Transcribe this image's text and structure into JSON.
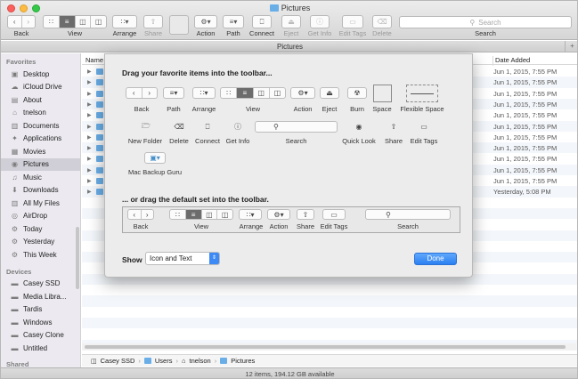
{
  "window": {
    "title": "Pictures",
    "tab_title": "Pictures",
    "status": "12 items, 194.12 GB available"
  },
  "toolbar": {
    "back": "Back",
    "view": "View",
    "arrange": "Arrange",
    "share": "Share",
    "action": "Action",
    "path": "Path",
    "connect": "Connect",
    "eject": "Eject",
    "get_info": "Get Info",
    "edit_tags": "Edit Tags",
    "delete": "Delete",
    "search_label": "Search",
    "search_placeholder": "Search"
  },
  "sidebar": {
    "favorites_header": "Favorites",
    "favorites": [
      {
        "label": "Desktop",
        "icon": "desktop-icon"
      },
      {
        "label": "iCloud Drive",
        "icon": "cloud-icon"
      },
      {
        "label": "About",
        "icon": "folder-icon"
      },
      {
        "label": "tnelson",
        "icon": "home-icon"
      },
      {
        "label": "Documents",
        "icon": "documents-icon"
      },
      {
        "label": "Applications",
        "icon": "applications-icon"
      },
      {
        "label": "Movies",
        "icon": "movies-icon"
      },
      {
        "label": "Pictures",
        "icon": "camera-icon"
      },
      {
        "label": "Music",
        "icon": "music-icon"
      },
      {
        "label": "Downloads",
        "icon": "downloads-icon"
      },
      {
        "label": "All My Files",
        "icon": "all-files-icon"
      },
      {
        "label": "AirDrop",
        "icon": "airdrop-icon"
      },
      {
        "label": "Today",
        "icon": "gear-icon"
      },
      {
        "label": "Yesterday",
        "icon": "gear-icon"
      },
      {
        "label": "This Week",
        "icon": "gear-icon"
      }
    ],
    "devices_header": "Devices",
    "devices": [
      {
        "label": "Casey SSD",
        "icon": "drive-icon"
      },
      {
        "label": "Media Libra...",
        "icon": "drive-icon"
      },
      {
        "label": "Tardis",
        "icon": "drive-icon"
      },
      {
        "label": "Windows",
        "icon": "drive-icon"
      },
      {
        "label": "Casey Clone",
        "icon": "drive-icon"
      },
      {
        "label": "Untitled",
        "icon": "drive-icon"
      }
    ],
    "shared_header": "Shared"
  },
  "list": {
    "col_name": "Name",
    "col_date": "Date Added",
    "dates": [
      "Jun 1, 2015, 7:55 PM",
      "Jun 1, 2015, 7:55 PM",
      "Jun 1, 2015, 7:55 PM",
      "Jun 1, 2015, 7:55 PM",
      "Jun 1, 2015, 7:55 PM",
      "Jun 1, 2015, 7:55 PM",
      "Jun 1, 2015, 7:55 PM",
      "Jun 1, 2015, 7:55 PM",
      "Jun 1, 2015, 7:55 PM",
      "Jun 1, 2015, 7:55 PM",
      "Jun 1, 2015, 7:55 PM",
      "Yesterday, 5:08 PM"
    ]
  },
  "path": [
    "Casey SSD",
    "Users",
    "tnelson",
    "Pictures"
  ],
  "customize": {
    "heading": "Drag your favorite items into the toolbar...",
    "items": {
      "back": "Back",
      "path": "Path",
      "arrange": "Arrange",
      "view": "View",
      "action": "Action",
      "eject": "Eject",
      "burn": "Burn",
      "space": "Space",
      "flexible_space": "Flexible Space",
      "new_folder": "New Folder",
      "delete": "Delete",
      "connect": "Connect",
      "get_info": "Get Info",
      "search": "Search",
      "quick_look": "Quick Look",
      "share": "Share",
      "edit_tags": "Edit Tags",
      "mac_backup_guru": "Mac Backup Guru"
    },
    "default_heading": "... or drag the default set into the toolbar.",
    "default_set": {
      "back": "Back",
      "view": "View",
      "arrange": "Arrange",
      "action": "Action",
      "share": "Share",
      "edit_tags": "Edit Tags",
      "search": "Search"
    },
    "show_label": "Show",
    "show_value": "Icon and Text",
    "done": "Done"
  }
}
